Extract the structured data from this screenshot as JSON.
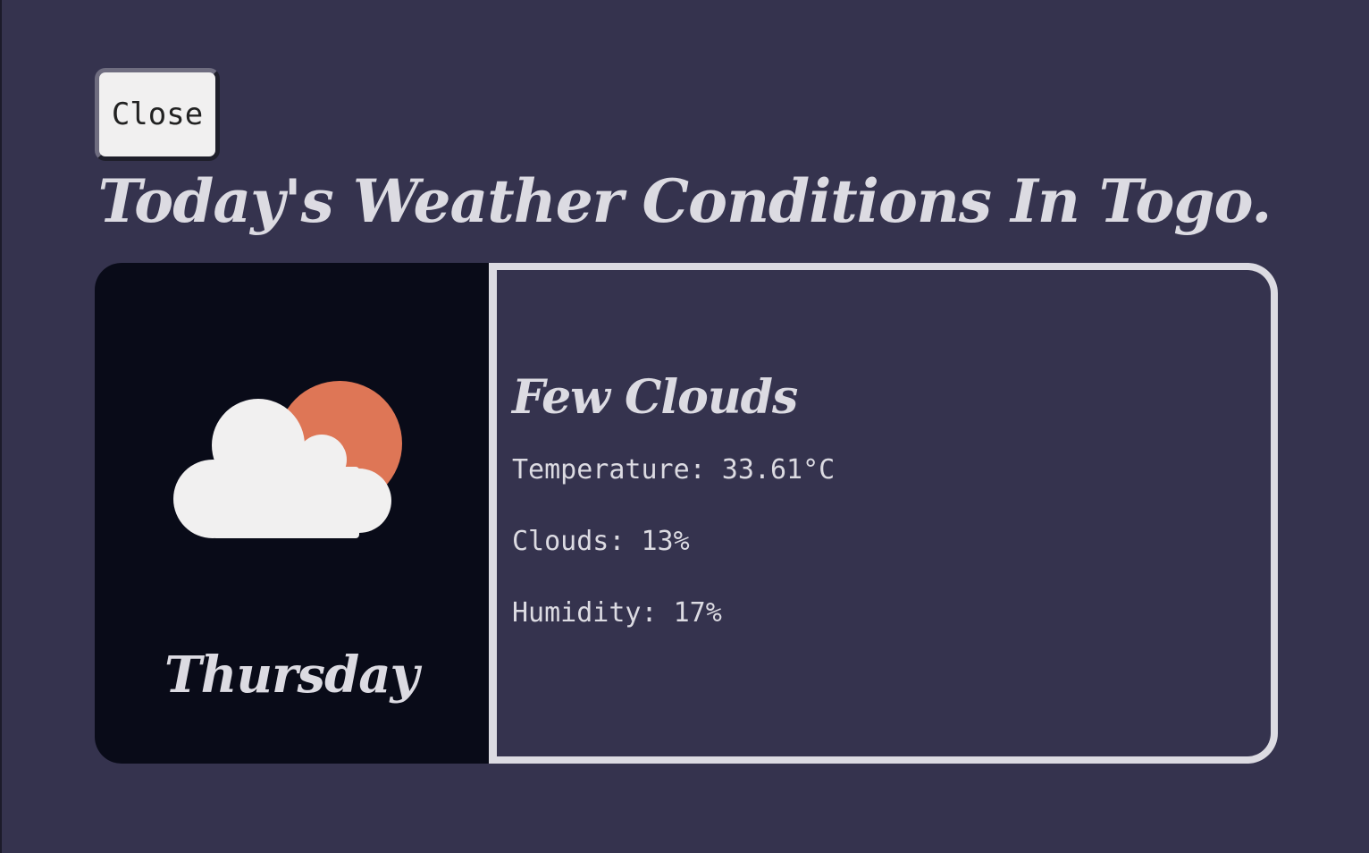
{
  "close_button": {
    "label": "Close"
  },
  "title": "Today's Weather Conditions In Togo.",
  "forecast": {
    "day": "Thursday",
    "icon": "cloud-sun-icon",
    "condition": "Few Clouds",
    "temperature_text": "Temperature: 33.61°C",
    "clouds_text": "Clouds: 13%",
    "humidity_text": "Humidity: 17%"
  },
  "colors": {
    "background": "#35334e",
    "card_dark": "#090b18",
    "text_light": "#dcdbe2",
    "sun": "#de7656",
    "cloud": "#f1f0f0"
  }
}
